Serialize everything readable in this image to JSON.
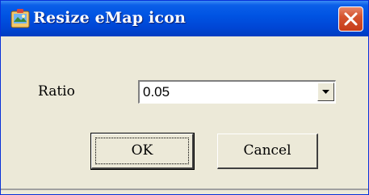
{
  "window": {
    "title": "Resize eMap icon",
    "title_icon": "emap-app-icon",
    "close_icon": "close-icon"
  },
  "form": {
    "ratio_label": "Ratio",
    "ratio_value": "0.05",
    "dropdown_icon": "chevron-down-icon"
  },
  "buttons": {
    "ok_label": "OK",
    "cancel_label": "Cancel"
  },
  "colors": {
    "titlebar": "#0054e3",
    "dialog_background": "#ece9d8",
    "close_button": "#c63c19"
  }
}
